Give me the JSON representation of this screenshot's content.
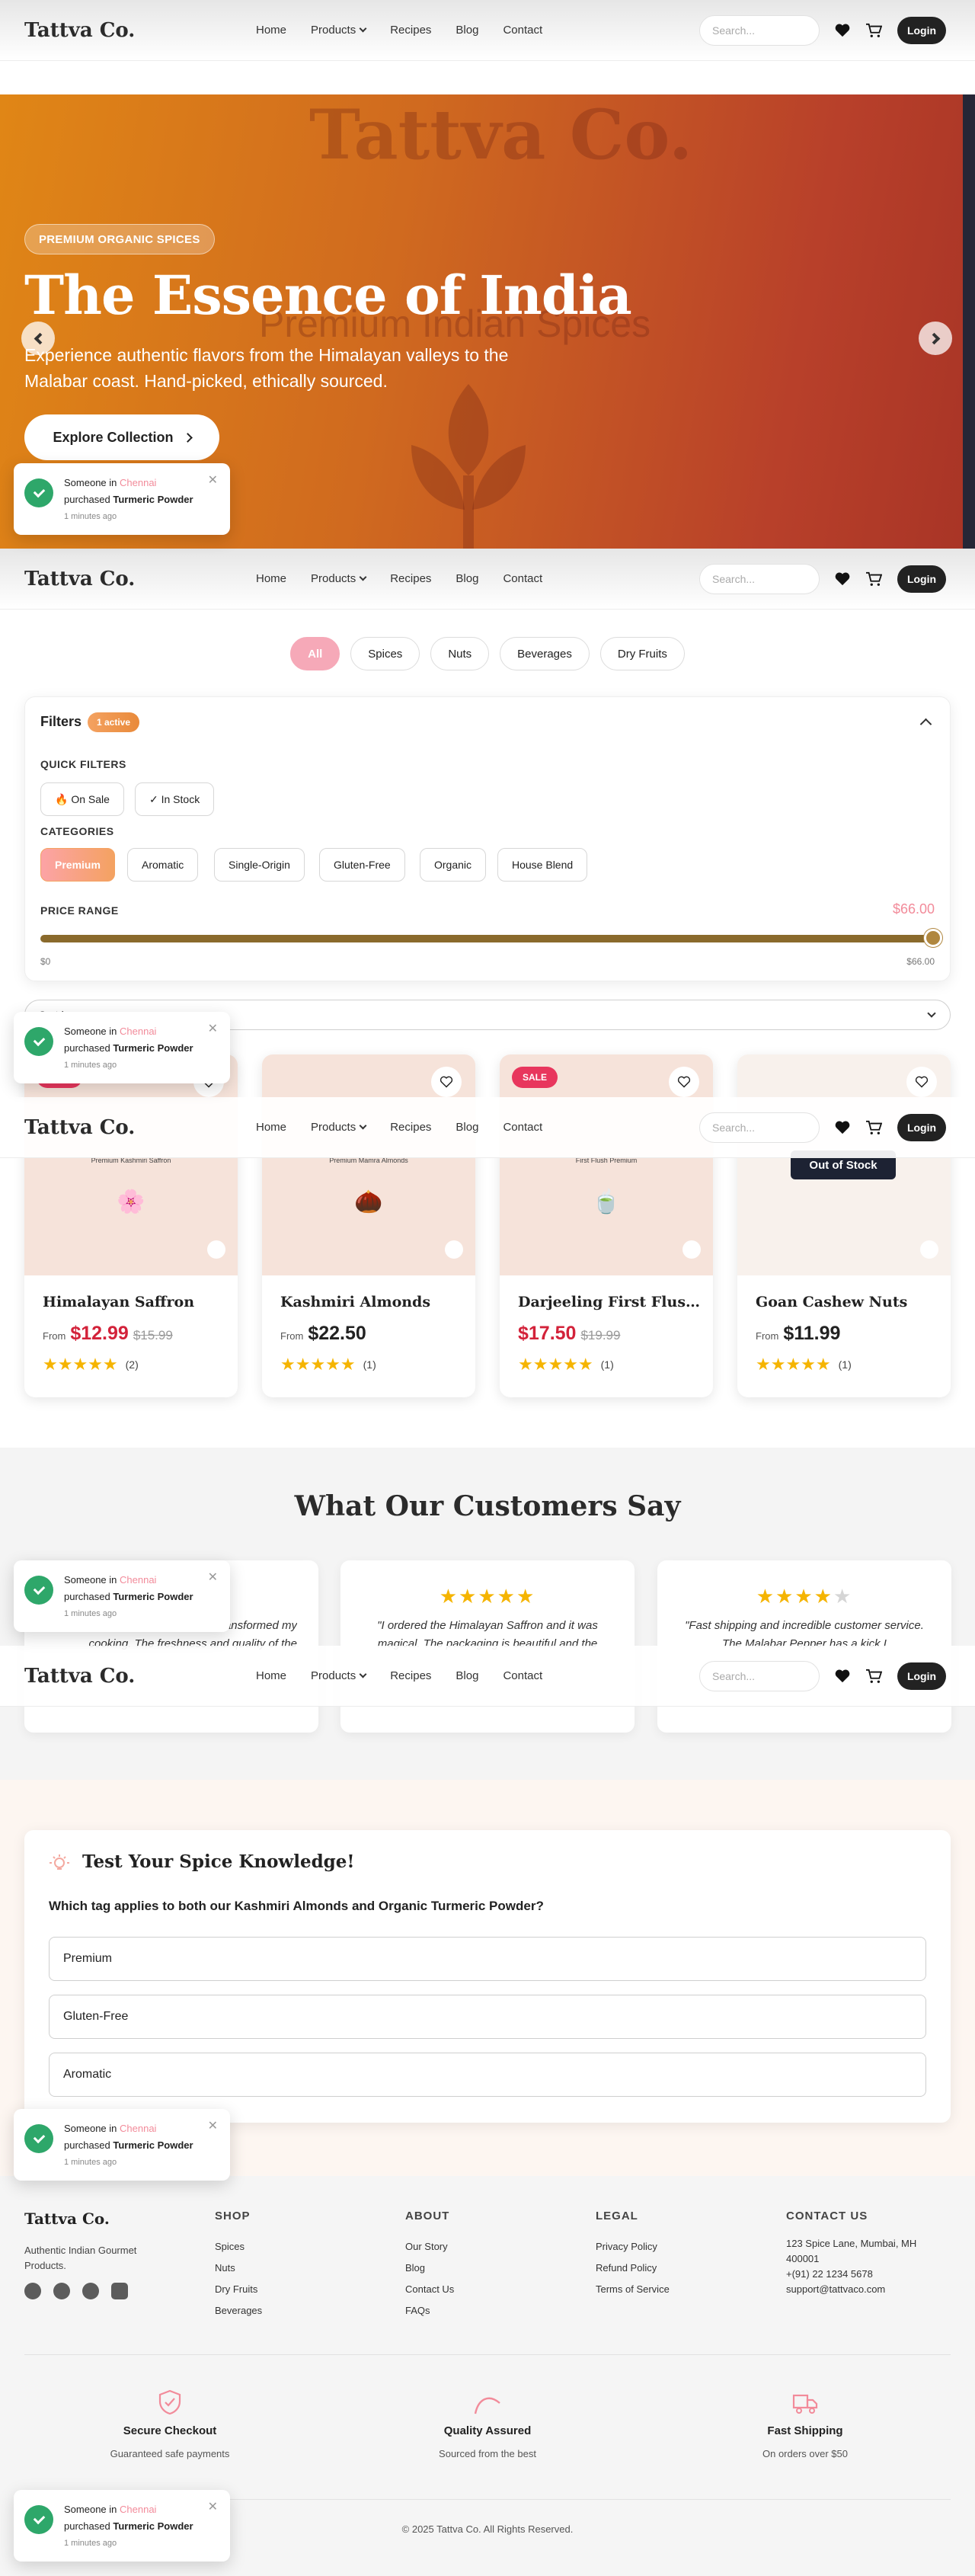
{
  "brand": "Tattva Co.",
  "nav": {
    "links": [
      "Home",
      "Products",
      "Recipes",
      "Blog",
      "Contact"
    ],
    "search_placeholder": "Search...",
    "login": "Login"
  },
  "hero": {
    "ghost_title": "Tattva Co.",
    "ghost_subtitle": "Premium Indian Spices",
    "pill": "PREMIUM ORGANIC SPICES",
    "title": "The Essence of India",
    "description": "Experience authentic flavors from the Himalayan valleys to the Malabar coast. Hand-picked, ethically sourced.",
    "cta": "Explore Collection"
  },
  "category_pills": [
    "All",
    "Spices",
    "Nuts",
    "Beverages",
    "Dry Fruits"
  ],
  "filters": {
    "title": "Filters",
    "badge": "1 active",
    "quick_label": "QUICK FILTERS",
    "quick": [
      "🔥 On Sale",
      "✓ In Stock"
    ],
    "categories_label": "CATEGORIES",
    "categories": [
      "Premium",
      "Aromatic",
      "Single-Origin",
      "Gluten-Free",
      "Organic",
      "House Blend"
    ],
    "price_label": "PRICE RANGE",
    "price_current": "$66.00",
    "price_min": "$0",
    "price_max": "$66.00",
    "price_fraction": 1.0
  },
  "sort": {
    "value": "Sort by"
  },
  "products": [
    {
      "name": "Himalayan Saffron",
      "sub": "Premium Kashmiri Saffron",
      "emoji": "🌸",
      "from": "From",
      "price": "$12.99",
      "was": "$15.99",
      "sale": "SALE",
      "stars": "★★★★★",
      "count": "(2)"
    },
    {
      "name": "Kashmiri Almonds",
      "sub": "Premium Mamra Almonds",
      "emoji": "🌰",
      "from": "From",
      "price": "$22.50",
      "was": "",
      "sale": "",
      "stars": "★★★★★",
      "count": "(1)"
    },
    {
      "name": "Darjeeling First Flush ...",
      "sub": "First Flush Premium",
      "emoji": "🍵",
      "from": "",
      "price": "$17.50",
      "was": "$19.99",
      "sale": "SALE",
      "stars": "★★★★★",
      "count": "(1)"
    },
    {
      "name": "Goan Cashew Nuts",
      "sub": "",
      "emoji": "",
      "from": "From",
      "price": "$11.99",
      "was": "",
      "sale": "",
      "oos": "Out of Stock",
      "stars": "★★★★★",
      "count": "(1)"
    }
  ],
  "testimonials": {
    "title": "What Our Customers Say",
    "items": [
      {
        "stars_on": "★★★★★",
        "stars_off": "",
        "text": "\"Tattva Co.'s spices have transformed my cooking. The freshness and quality of the"
      },
      {
        "stars_on": "★★★★★",
        "stars_off": "",
        "text": "\"I ordered the Himalayan Saffron and it was magical. The packaging is beautiful and the"
      },
      {
        "stars_on": "★★★★",
        "stars_off": "★",
        "text": "\"Fast shipping and incredible customer service. The Malabar Pepper has a kick I"
      }
    ]
  },
  "quiz": {
    "title": "Test Your Spice Knowledge!",
    "question": "Which tag applies to both our Kashmiri Almonds and Organic Turmeric Powder?",
    "options": [
      "Premium",
      "Gluten-Free",
      "Aromatic"
    ]
  },
  "toast": {
    "prefix": "Someone in",
    "city": "Chennai",
    "purchased": "purchased",
    "product": "Turmeric Powder",
    "time": "1 minutes ago"
  },
  "footer": {
    "brand": "Tattva Co.",
    "tagline": "Authentic Indian Gourmet Products.",
    "columns": [
      {
        "title": "SHOP",
        "items": [
          "Spices",
          "Nuts",
          "Dry Fruits",
          "Beverages"
        ]
      },
      {
        "title": "ABOUT",
        "items": [
          "Our Story",
          "Blog",
          "Contact Us",
          "FAQs"
        ]
      },
      {
        "title": "LEGAL",
        "items": [
          "Privacy Policy",
          "Refund Policy",
          "Terms of Service"
        ]
      },
      {
        "title": "CONTACT US",
        "items": [
          "123 Spice Lane, Mumbai, MH 400001",
          "+(91) 22 1234 5678",
          "support@tattvaco.com"
        ]
      }
    ],
    "features": [
      {
        "title": "Secure Checkout",
        "sub": "Guaranteed safe payments"
      },
      {
        "title": "Quality Assured",
        "sub": "Sourced from the best"
      },
      {
        "title": "Fast Shipping",
        "sub": "On orders over $50"
      }
    ],
    "copyright": "© 2025 Tattva Co. All Rights Reserved."
  },
  "colors": {
    "accent": "#f28b9a",
    "hero_start": "#e08616",
    "hero_end": "#a83426",
    "sale": "#e8365d",
    "star": "#f5b400"
  }
}
